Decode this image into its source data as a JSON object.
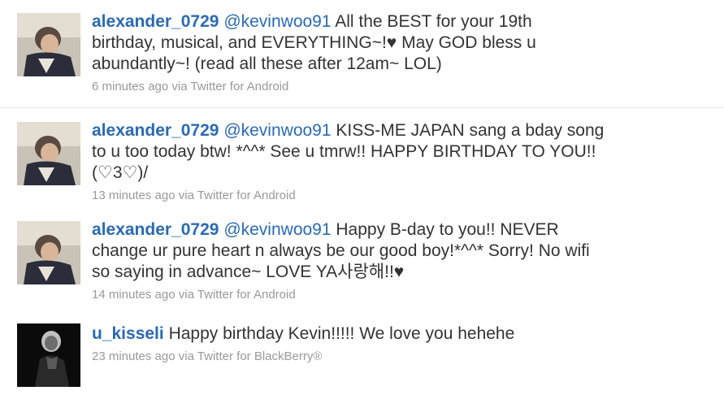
{
  "tweets": [
    {
      "username": "alexander_0729",
      "mention": "@kevinwoo91",
      "lines": [
        "All the BEST for your 19th",
        "birthday, musical, and EVERYTHING~!♥ May GOD bless u",
        "abundantly~! (read all these after 12am~ LOL)"
      ],
      "meta": "6 minutes ago via Twitter for Android"
    },
    {
      "username": "alexander_0729",
      "mention": "@kevinwoo91",
      "lines": [
        "KISS-ME JAPAN sang a bday song",
        "to u too today btw! *^^* See u tmrw!! HAPPY BIRTHDAY TO YOU!!",
        "(♡3♡)/"
      ],
      "meta": "13 minutes ago via Twitter for Android"
    },
    {
      "username": "alexander_0729",
      "mention": "@kevinwoo91",
      "lines": [
        "Happy B-day to you!! NEVER",
        "change ur pure heart n always be our good boy!*^^* Sorry! No wifi",
        "so saying in advance~ LOVE YA사랑해!!♥"
      ],
      "meta": "14 minutes ago via Twitter for Android"
    },
    {
      "username": "u_kisseli",
      "mention": "",
      "lines": [
        "Happy birthday Kevin!!!!! We love you hehehe"
      ],
      "meta": "23 minutes ago via Twitter for BlackBerry®"
    }
  ]
}
